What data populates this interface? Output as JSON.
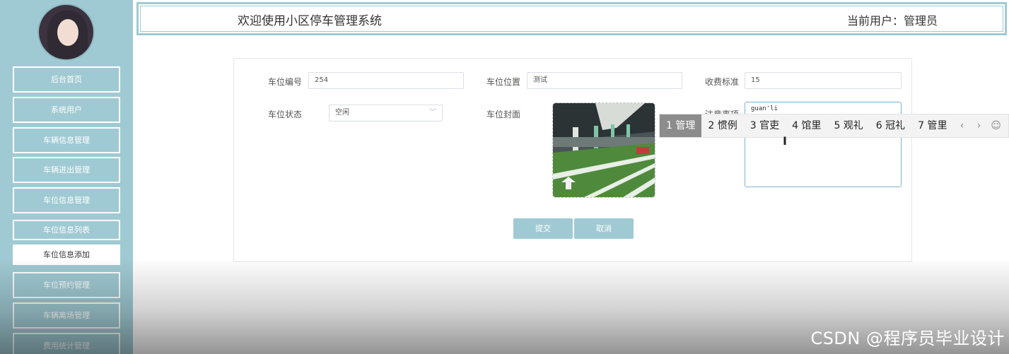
{
  "sidebar": {
    "items": [
      {
        "label": "后台首页"
      },
      {
        "label": "系统用户"
      },
      {
        "label": "车辆信息管理"
      },
      {
        "label": "车辆进出管理"
      },
      {
        "label": "车位信息管理"
      },
      {
        "label": "车位信息列表"
      },
      {
        "label": "车位信息添加"
      },
      {
        "label": "车位预约管理"
      },
      {
        "label": "车辆离场管理"
      },
      {
        "label": "费用统计管理"
      }
    ]
  },
  "header": {
    "title": "欢迎使用小区停车管理系统",
    "current_user": "当前用户：管理员"
  },
  "form": {
    "space_no_label": "车位编号",
    "space_no_value": "254",
    "location_label": "车位位置",
    "location_value": "测试",
    "fee_label": "收费标准",
    "fee_value": "15",
    "status_label": "车位状态",
    "status_value": "空闲",
    "cover_label": "车位封面",
    "notes_label": "注意事项",
    "notes_value": "guan'li",
    "submit_label": "提交",
    "cancel_label": "取消"
  },
  "ime": {
    "candidates": [
      "1 管理",
      "2 惯例",
      "3 官吏",
      "4 馆里",
      "5 观礼",
      "6 冠礼",
      "7 管里"
    ],
    "prev": "‹",
    "next": "›",
    "emoji": "☺"
  },
  "watermark": "CSDN @程序员毕业设计",
  "colors": {
    "accent": "#a0cad3",
    "ime_selected": "#8c8c8c"
  }
}
